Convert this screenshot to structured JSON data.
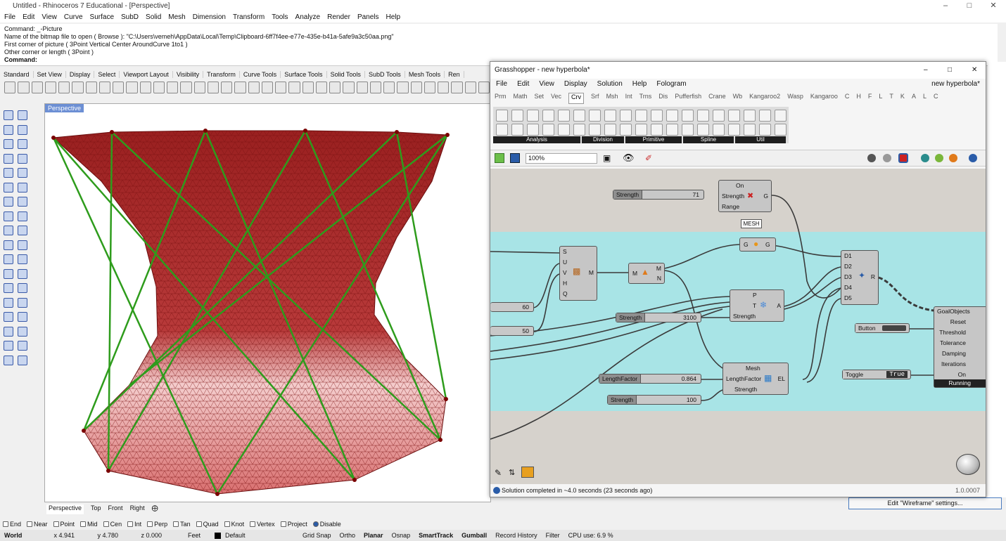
{
  "app": {
    "title": "Untitled - Rhinoceros 7 Educational - [Perspective]"
  },
  "menu": [
    "File",
    "Edit",
    "View",
    "Curve",
    "Surface",
    "SubD",
    "Solid",
    "Mesh",
    "Dimension",
    "Transform",
    "Tools",
    "Analyze",
    "Render",
    "Panels",
    "Help"
  ],
  "command": {
    "lines": [
      "Command: _-Picture",
      "Name of the bitmap file to open ( Browse ): \"C:\\Users\\vemeh\\AppData\\Local\\Temp\\Clipboard-6ff7f4ee-e77e-435e-b41a-5afe9a3c50aa.png\"",
      "First corner of picture ( 3Point  Vertical  Center  AroundCurve  1to1 )",
      "Other corner or length ( 3Point )"
    ],
    "prompt": "Command:"
  },
  "toolbar_tabs": [
    "Standard",
    "Set View",
    "Display",
    "Select",
    "Viewport Layout",
    "Visibility",
    "Transform",
    "Curve Tools",
    "Surface Tools",
    "Solid Tools",
    "SubD Tools",
    "Mesh Tools",
    "Ren"
  ],
  "viewport": {
    "label": "Perspective",
    "tabs": [
      "Perspective",
      "Top",
      "Front",
      "Right"
    ]
  },
  "osnaps": [
    {
      "label": "End",
      "checked": false
    },
    {
      "label": "Near",
      "checked": false
    },
    {
      "label": "Point",
      "checked": false
    },
    {
      "label": "Mid",
      "checked": false
    },
    {
      "label": "Cen",
      "checked": false
    },
    {
      "label": "Int",
      "checked": false
    },
    {
      "label": "Perp",
      "checked": false
    },
    {
      "label": "Tan",
      "checked": false
    },
    {
      "label": "Quad",
      "checked": false
    },
    {
      "label": "Knot",
      "checked": false
    },
    {
      "label": "Vertex",
      "checked": false
    },
    {
      "label": "Project",
      "checked": false
    },
    {
      "label": "Disable",
      "checked": true
    }
  ],
  "status": {
    "cplane": "World",
    "x": "x 4.941",
    "y": "y 4.780",
    "z": "z 0.000",
    "units": "Feet",
    "layer": "Default",
    "items": [
      "Grid Snap",
      "Ortho",
      "Planar",
      "Osnap",
      "SmartTrack",
      "Gumball",
      "Record History",
      "Filter",
      "CPU use: 6.9 %"
    ]
  },
  "edit_wireframe": "Edit \"Wireframe\" settings...",
  "gh": {
    "title": "Grasshopper - new hyperbola*",
    "menu": [
      "File",
      "Edit",
      "View",
      "Display",
      "Solution",
      "Help",
      "Fologram"
    ],
    "doc": "new hyperbola*",
    "tabs": [
      "Prm",
      "Math",
      "Set",
      "Vec",
      "Crv",
      "Srf",
      "Msh",
      "Int",
      "Trns",
      "Dis",
      "Pufferfish",
      "Crane",
      "Wb",
      "Kangaroo2",
      "Wasp",
      "Kangaroo",
      "C",
      "H",
      "F",
      "L",
      "T",
      "K",
      "A",
      "L",
      "C"
    ],
    "active_tab": "Crv",
    "groups": [
      "Analysis",
      "Division",
      "Primitive",
      "Spline",
      "Util"
    ],
    "zoom": "100%",
    "status": "Solution completed in ~4.0 seconds (23 seconds ago)",
    "version": "1.0.0007",
    "sliders": [
      {
        "label": "Strength",
        "value": "71"
      },
      {
        "label": "",
        "value": "60"
      },
      {
        "label": "",
        "value": "50"
      },
      {
        "label": "Strength",
        "value": "3100"
      },
      {
        "label": "LengthFactor",
        "value": "0.864"
      },
      {
        "label": "Strength",
        "value": "100"
      }
    ],
    "anchor": {
      "inputs": [
        "On",
        "Strength",
        "Range"
      ],
      "output": "G"
    },
    "mesh_tag": "MESH",
    "cap": {
      "input": "G",
      "output": "G"
    },
    "mesh_comp": {
      "inputs": [
        "S",
        "U",
        "V",
        "H",
        "Q"
      ],
      "output": "M"
    },
    "mn": {
      "input": "M",
      "outputs": [
        "M",
        "N"
      ]
    },
    "load": {
      "inputs": [
        "P",
        "T",
        "Strength"
      ],
      "output": "A"
    },
    "entwine": {
      "inputs": [
        "D1",
        "D2",
        "D3",
        "D4",
        "D5"
      ],
      "output": "R"
    },
    "edgelen": {
      "inputs": [
        "Mesh",
        "LengthFactor",
        "Strength"
      ],
      "output": "EL"
    },
    "solver": {
      "inputs": [
        "GoalObjects",
        "Reset",
        "Threshold",
        "Tolerance",
        "Damping",
        "Iterations",
        "On"
      ],
      "state": "Running"
    },
    "button": "Button",
    "toggle": {
      "label": "Toggle",
      "value": "True"
    }
  }
}
